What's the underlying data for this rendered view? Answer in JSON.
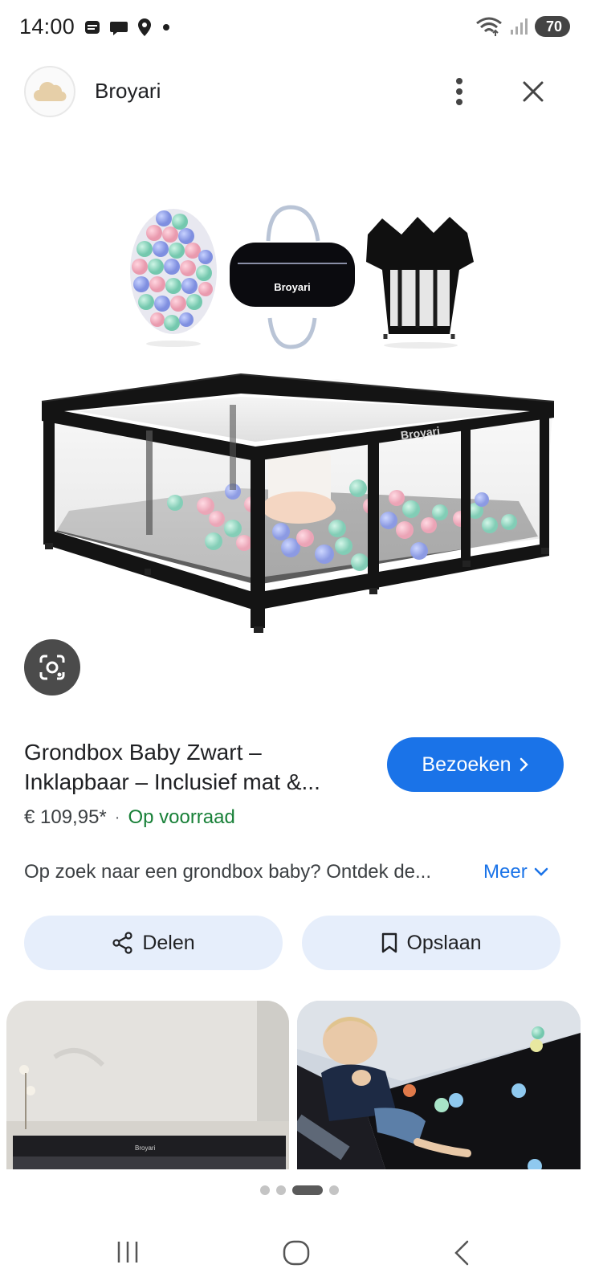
{
  "status_bar": {
    "time": "14:00",
    "battery": "70",
    "left_icons": [
      "message-icon",
      "chat-icon",
      "location-icon",
      "dot-icon"
    ],
    "right_icons": [
      "wifi-icon",
      "signal-icon",
      "battery-icon"
    ]
  },
  "source": {
    "name": "Broyari",
    "logo_icon": "cloud-logo-icon",
    "more_icon": "more-vert-icon",
    "close_icon": "close-icon"
  },
  "main_image": {
    "brand_text_bag": "Broyari",
    "brand_text_playpen": "Broyari"
  },
  "product": {
    "title": "Grondbox Baby Zwart – Inklapbaar – Inclusief mat &...",
    "price": "€ 109,95*",
    "separator": "·",
    "stock": "Op voorraad",
    "description": "Op zoek naar een grondbox baby? Ontdek de...",
    "more_label": "Meer",
    "visit_label": "Bezoeken",
    "accent_color": "#1a73e8",
    "stock_color": "#188038"
  },
  "actions": {
    "share_label": "Delen",
    "save_label": "Opslaan"
  },
  "related": {
    "thumb1_brand": "Broyari"
  },
  "pagination": {
    "count": 4,
    "active_index": 2
  },
  "nav": {
    "recent_icon": "recent-apps-icon",
    "home_icon": "home-icon",
    "back_icon": "back-icon"
  }
}
